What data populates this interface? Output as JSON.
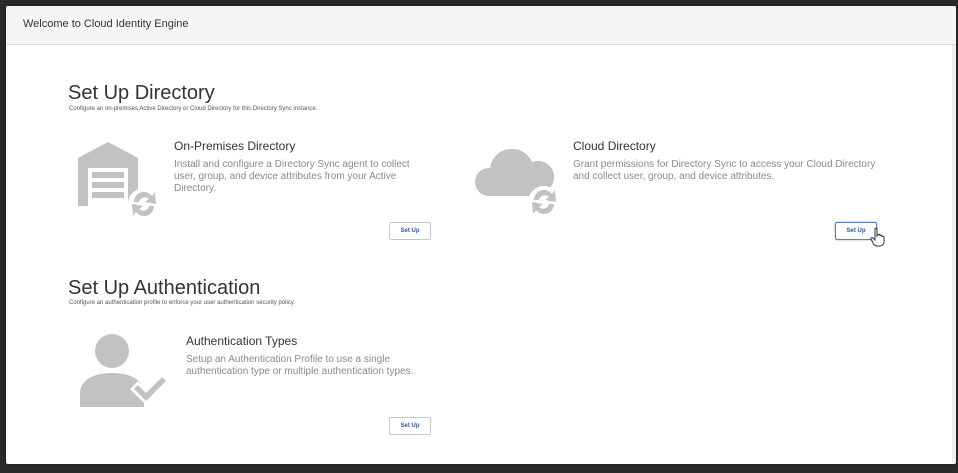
{
  "window": {
    "title": "Welcome to Cloud Identity Engine"
  },
  "directory_section": {
    "title": "Set Up Directory",
    "subtitle": "Configure an on-premises Active Directory or Cloud Directory for this Directory Sync instance.",
    "cards": [
      {
        "title": "On-Premises Directory",
        "description": "Install and configure a Directory Sync agent to collect user, group, and device attributes from your Active Directory.",
        "icon": "warehouse-sync-icon",
        "button_label": "Set Up"
      },
      {
        "title": "Cloud Directory",
        "description": "Grant permissions for Directory Sync to access your Cloud Directory and collect user, group, and device attributes.",
        "icon": "cloud-sync-icon",
        "button_label": "Set Up"
      }
    ]
  },
  "auth_section": {
    "title": "Set Up Authentication",
    "subtitle": "Configure an authentication profile to enforce your user authentication security policy.",
    "cards": [
      {
        "title": "Authentication Types",
        "description": "Setup an Authentication Profile to use a single authentication type or multiple authentication types.",
        "icon": "user-check-icon",
        "button_label": "Set Up"
      }
    ]
  },
  "colors": {
    "icon_gray": "#c2c2c2",
    "button_text": "#2a5aa0",
    "background": "#ffffff"
  }
}
